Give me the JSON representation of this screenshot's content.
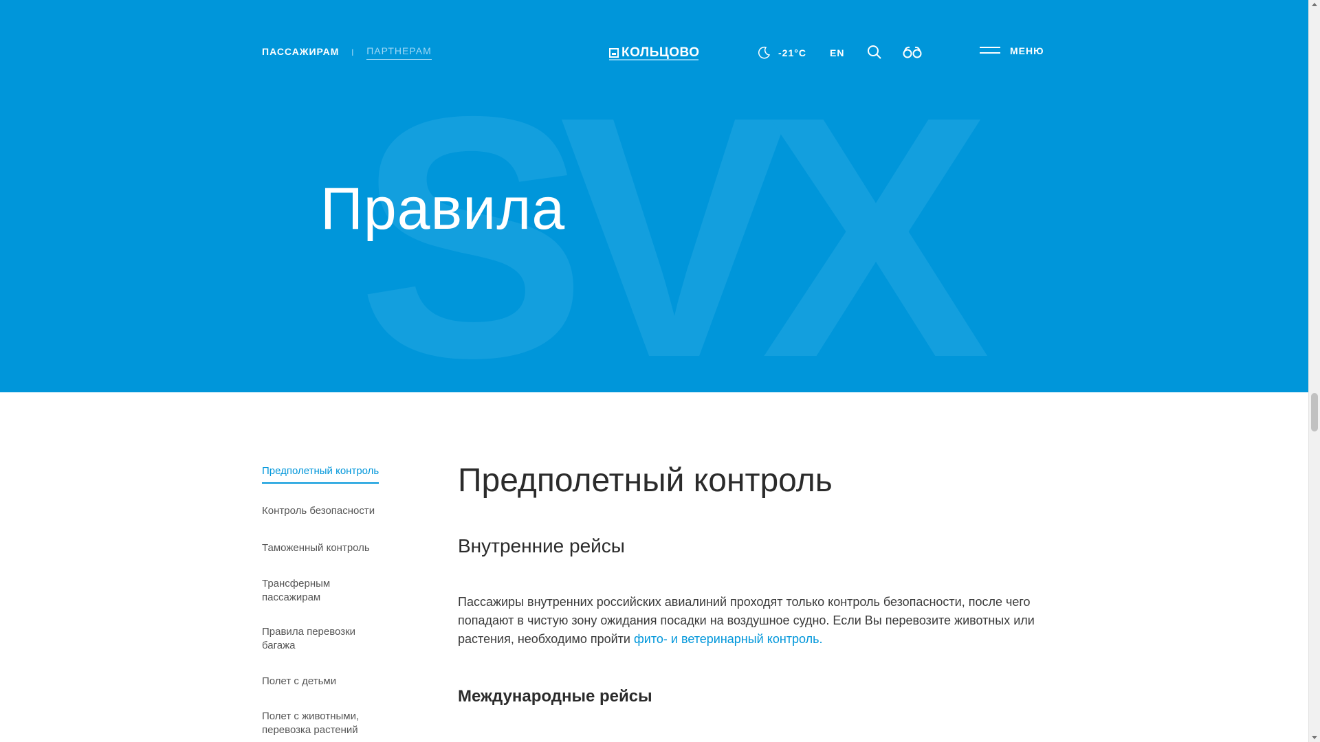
{
  "header": {
    "nav": [
      {
        "label": "ПАССАЖИРАМ"
      },
      {
        "label": "ПАРТНЕРАМ"
      }
    ],
    "logo_text": "КОЛЬЦОВО",
    "weather": {
      "temperature": "-21°C",
      "icon": "moon-icon"
    },
    "lang": "EN",
    "search_icon": "search-icon",
    "accessibility_icon": "glasses-icon",
    "menu_label": "МЕНЮ"
  },
  "hero": {
    "title": "Правила",
    "watermark": "SVX",
    "background": "#0096da"
  },
  "sidebar": {
    "items": [
      {
        "label": "Предполетный контроль",
        "active": true
      },
      {
        "label": "Контроль безопасности"
      },
      {
        "label": "Таможенный контроль"
      },
      {
        "label": "Трансферным пассажирам"
      },
      {
        "label": "Правила перевозки багажа"
      },
      {
        "label": "Полет с детьми"
      },
      {
        "label": "Полет с животными, перевозка растений"
      }
    ]
  },
  "content": {
    "title": "Предполетный контроль",
    "section1_title": "Внутренние рейсы",
    "section1_text": "Пассажиры внутренних российских авиалиний проходят только контроль безопасности, после чего попадают в чистую зону ожидания посадки на воздушное судно. Если Вы перевозите животных или растения, необходимо пройти ",
    "section1_link": "фито- и ветеринарный контроль.",
    "section2_title": "Международные рейсы"
  },
  "colors": {
    "accent": "#0096da"
  }
}
